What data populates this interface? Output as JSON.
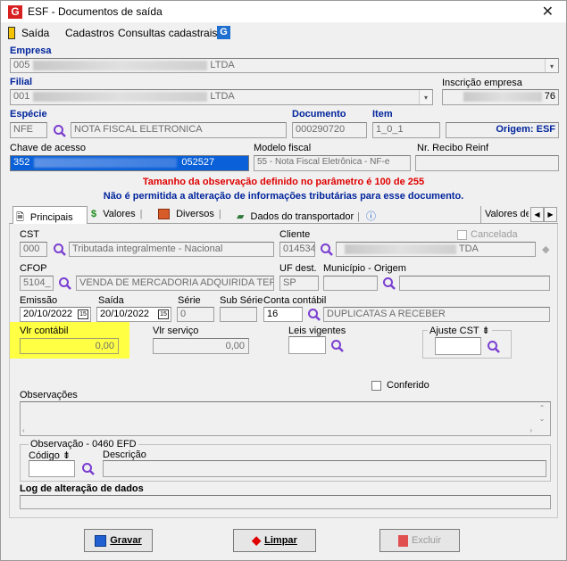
{
  "window": {
    "title": "ESF - Documentos de saída",
    "app_icon_letter": "G"
  },
  "menu": {
    "items": [
      "Saída",
      "Cadastros",
      "Consultas cadastrais"
    ]
  },
  "header": {
    "empresa_label": "Empresa",
    "empresa_prefix": "005",
    "empresa_suffix": "LTDA",
    "filial_label": "Filial",
    "filial_prefix": "001",
    "filial_suffix": "LTDA",
    "inscricao_label": "Inscrição empresa",
    "inscricao_suffix": "76",
    "especie_label": "Espécie",
    "especie_code": "NFE",
    "especie_desc": "NOTA FISCAL ELETRONICA",
    "documento_label": "Documento",
    "documento_value": "000290720",
    "item_label": "Item",
    "item_value": "1_0_1",
    "origem_label": "Origem: ESF",
    "chave_label": "Chave de acesso",
    "chave_prefix": "352",
    "chave_suffix": "052527",
    "modelo_label": "Modelo fiscal",
    "modelo_value": "55 - Nota Fiscal Eletrônica - NF-e",
    "recibo_label": "Nr. Recibo Reinf",
    "recibo_value": ""
  },
  "warnings": {
    "line1": "Tamanho da observação definido no parâmetro é 100 de 255",
    "line2": "Não é permitida a alteração de informações tributárias para esse documento."
  },
  "tabs": [
    "Principais",
    "Valores",
    "Diversos",
    "Dados do transportador",
    "Valores de ir"
  ],
  "principal": {
    "cst_label": "CST",
    "cst_code": "000",
    "cst_desc": "Tributada integralmente - Nacional",
    "cliente_label": "Cliente",
    "cliente_code": "014534",
    "cliente_suffix": "TDA",
    "cancelada_label": "Cancelada",
    "cfop_label": "CFOP",
    "cfop_code": "5104_",
    "cfop_desc": "VENDA DE MERCADORIA ADQUIRIDA TERC",
    "uf_label": "UF dest.",
    "uf_value": "SP",
    "municipio_label": "Município - Origem",
    "municipio_value": "",
    "emissao_label": "Emissão",
    "emissao_value": "20/10/2022",
    "saida_label": "Saída",
    "saida_value": "20/10/2022",
    "serie_label": "Série",
    "serie_value": "0",
    "subserie_label": "Sub Série",
    "subserie_value": "",
    "conta_label": "Conta contábil",
    "conta_code": "16",
    "conta_desc": "DUPLICATAS A RECEBER",
    "vlr_contabil_label": "Vlr contábil",
    "vlr_contabil_value": "0,00",
    "vlr_servico_label": "Vlr serviço",
    "vlr_servico_value": "0,00",
    "leis_label": "Leis vigentes",
    "leis_value": "",
    "ajuste_label": "Ajuste CST",
    "ajuste_value": "",
    "conferido_label": "Conferido",
    "observacoes_label": "Observações",
    "obs0460_label": "Observação - 0460 EFD",
    "codigo_label": "Código",
    "descricao_label": "Descrição",
    "log_label": "Log de alteração de dados"
  },
  "buttons": {
    "gravar": "Gravar",
    "limpar": "Limpar",
    "excluir": "Excluir"
  },
  "colors": {
    "accent_blue": "#00249c",
    "warning_red": "#e00000",
    "highlight_yellow": "#ffff44"
  }
}
